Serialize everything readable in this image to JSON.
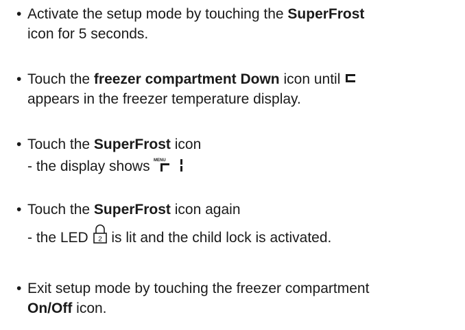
{
  "steps": [
    {
      "line1_a": "Activate the setup mode by touching the ",
      "line1_b": "SuperFrost",
      "line2": "icon for 5 seconds."
    },
    {
      "line1_a": "Touch the ",
      "line1_b": "freezer compartment Down",
      "line1_c": " icon until ",
      "line2": "appears in the freezer temperature display."
    },
    {
      "line1_a": "Touch the ",
      "line1_b": "SuperFrost",
      "line1_c": " icon",
      "sub_a": "- the display shows "
    },
    {
      "line1_a": "Touch the ",
      "line1_b": "SuperFrost",
      "line1_c": " icon again",
      "sub_a": "- the LED ",
      "sub_b": " is lit and the child lock is activated."
    },
    {
      "line1": "Exit setup mode by touching the freezer compartment",
      "line2_b": "On/Off",
      "line2_c": " icon."
    }
  ],
  "icons": {
    "menu_text": "MENU",
    "lock_digit": "2"
  }
}
